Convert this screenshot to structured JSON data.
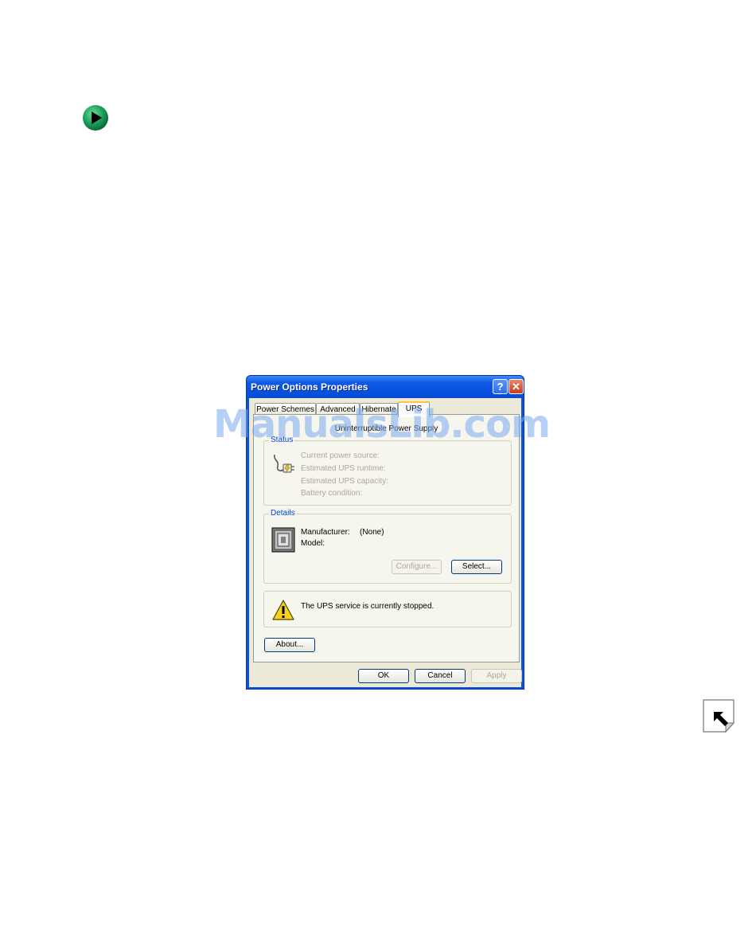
{
  "dialog": {
    "title": "Power Options Properties",
    "help_button": "?",
    "close_button": "✕"
  },
  "tabs": [
    {
      "label": "Power Schemes",
      "active": false
    },
    {
      "label": "Advanced",
      "active": false
    },
    {
      "label": "Hibernate",
      "active": false
    },
    {
      "label": "UPS",
      "active": true
    }
  ],
  "ups_panel": {
    "heading": "Uninterruptible Power Supply",
    "status": {
      "label": "Status",
      "icon": "ups-plug-icon",
      "lines": [
        "Current power source:",
        "Estimated UPS runtime:",
        "Estimated UPS capacity:",
        "Battery condition:"
      ]
    },
    "details": {
      "label": "Details",
      "icon": "ups-device-icon",
      "manufacturer_label": "Manufacturer:",
      "manufacturer_value": "(None)",
      "model_label": "Model:",
      "configure_button": "Configure...",
      "select_button": "Select..."
    },
    "warning": {
      "icon": "warning-icon",
      "message": "The UPS service is currently stopped."
    },
    "about_button": "About..."
  },
  "footer": {
    "ok_button": "OK",
    "cancel_button": "Cancel",
    "apply_button": "Apply"
  },
  "watermark": "ManualsLib.com",
  "colors": {
    "titlebar": "#0a54d8",
    "dialog_face": "#ece9d8",
    "group_label": "#0046d5",
    "active_tab_accent": "#ffc83c",
    "bullet_green": "#1aa05a"
  }
}
